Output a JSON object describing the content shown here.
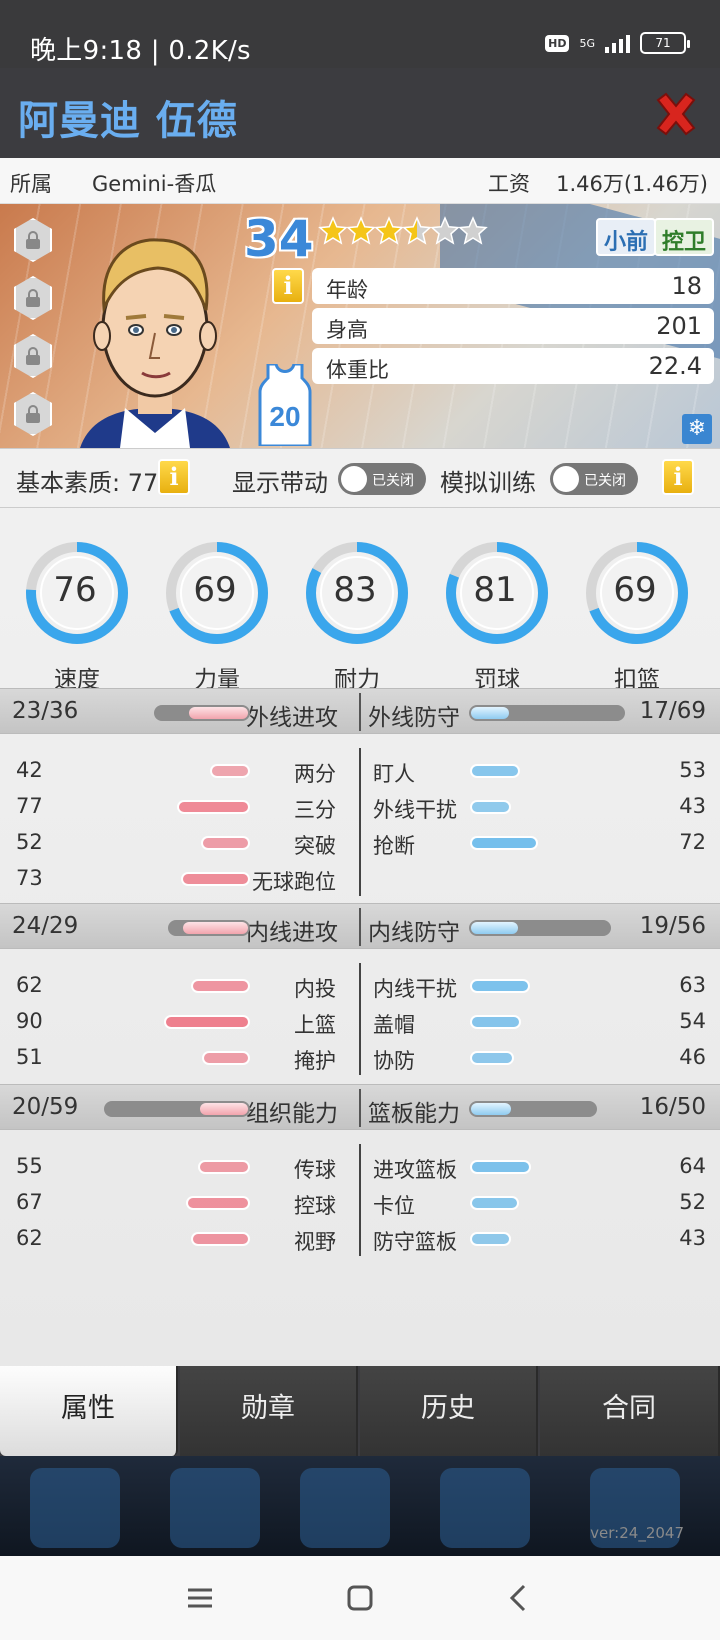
{
  "status_bar": {
    "time": "晚上9:18 | 0.2K/s",
    "hd": "HD",
    "network": "5G",
    "battery": "71"
  },
  "header": {
    "player_name": "阿曼迪 伍德"
  },
  "info": {
    "team_label": "所属",
    "team": "Gemini-香瓜",
    "salary_label": "工资",
    "salary": "1.46万(1.46万)"
  },
  "player": {
    "overall": "34",
    "stars_total": 6,
    "stars_filled": 3.5,
    "positions": [
      "小前",
      "控卫"
    ],
    "jersey_number": "20",
    "attributes": [
      {
        "label": "年龄",
        "value": "18"
      },
      {
        "label": "身高",
        "value": "201"
      },
      {
        "label": "体重比",
        "value": "22.4"
      }
    ]
  },
  "basic": {
    "label": "基本素质: 77",
    "show_drive_label": "显示带动",
    "sim_train_label": "模拟训练",
    "toggle_off_text": "已关闭"
  },
  "dials": [
    {
      "value": "76",
      "label": "速度"
    },
    {
      "value": "69",
      "label": "力量"
    },
    {
      "value": "83",
      "label": "耐力"
    },
    {
      "value": "81",
      "label": "罚球"
    },
    {
      "value": "69",
      "label": "扣篮"
    }
  ],
  "sections": [
    {
      "left_name": "外线进攻",
      "left_value": "23/36",
      "left_fraction": 0.64,
      "right_name": "外线防守",
      "right_value": "17/69",
      "right_fraction": 0.25,
      "left_items": [
        {
          "label": "两分",
          "value": "42"
        },
        {
          "label": "三分",
          "value": "77"
        },
        {
          "label": "突破",
          "value": "52"
        },
        {
          "label": "无球跑位",
          "value": "73"
        }
      ],
      "right_items": [
        {
          "label": "盯人",
          "value": "53"
        },
        {
          "label": "外线干扰",
          "value": "43"
        },
        {
          "label": "抢断",
          "value": "72"
        }
      ]
    },
    {
      "left_name": "内线进攻",
      "left_value": "24/29",
      "left_fraction": 0.83,
      "right_name": "内线防守",
      "right_value": "19/56",
      "right_fraction": 0.34,
      "left_items": [
        {
          "label": "内投",
          "value": "62"
        },
        {
          "label": "上篮",
          "value": "90"
        },
        {
          "label": "掩护",
          "value": "51"
        }
      ],
      "right_items": [
        {
          "label": "内线干扰",
          "value": "63"
        },
        {
          "label": "盖帽",
          "value": "54"
        },
        {
          "label": "协防",
          "value": "46"
        }
      ]
    },
    {
      "left_name": "组织能力",
      "left_value": "20/59",
      "left_fraction": 0.34,
      "right_name": "篮板能力",
      "right_value": "16/50",
      "right_fraction": 0.32,
      "left_items": [
        {
          "label": "传球",
          "value": "55"
        },
        {
          "label": "控球",
          "value": "67"
        },
        {
          "label": "视野",
          "value": "62"
        }
      ],
      "right_items": [
        {
          "label": "进攻篮板",
          "value": "64"
        },
        {
          "label": "卡位",
          "value": "52"
        },
        {
          "label": "防守篮板",
          "value": "43"
        }
      ]
    }
  ],
  "tabs": [
    {
      "label": "属性",
      "active": true
    },
    {
      "label": "勋章",
      "active": false
    },
    {
      "label": "历史",
      "active": false
    },
    {
      "label": "合同",
      "active": false
    }
  ],
  "version": "ver:24_2047",
  "colors": {
    "blue_accent": "#3b88d8",
    "pink_bar": "#f2a4ad",
    "blue_bar": "#8fcbf0",
    "close_red": "#d8251e"
  }
}
